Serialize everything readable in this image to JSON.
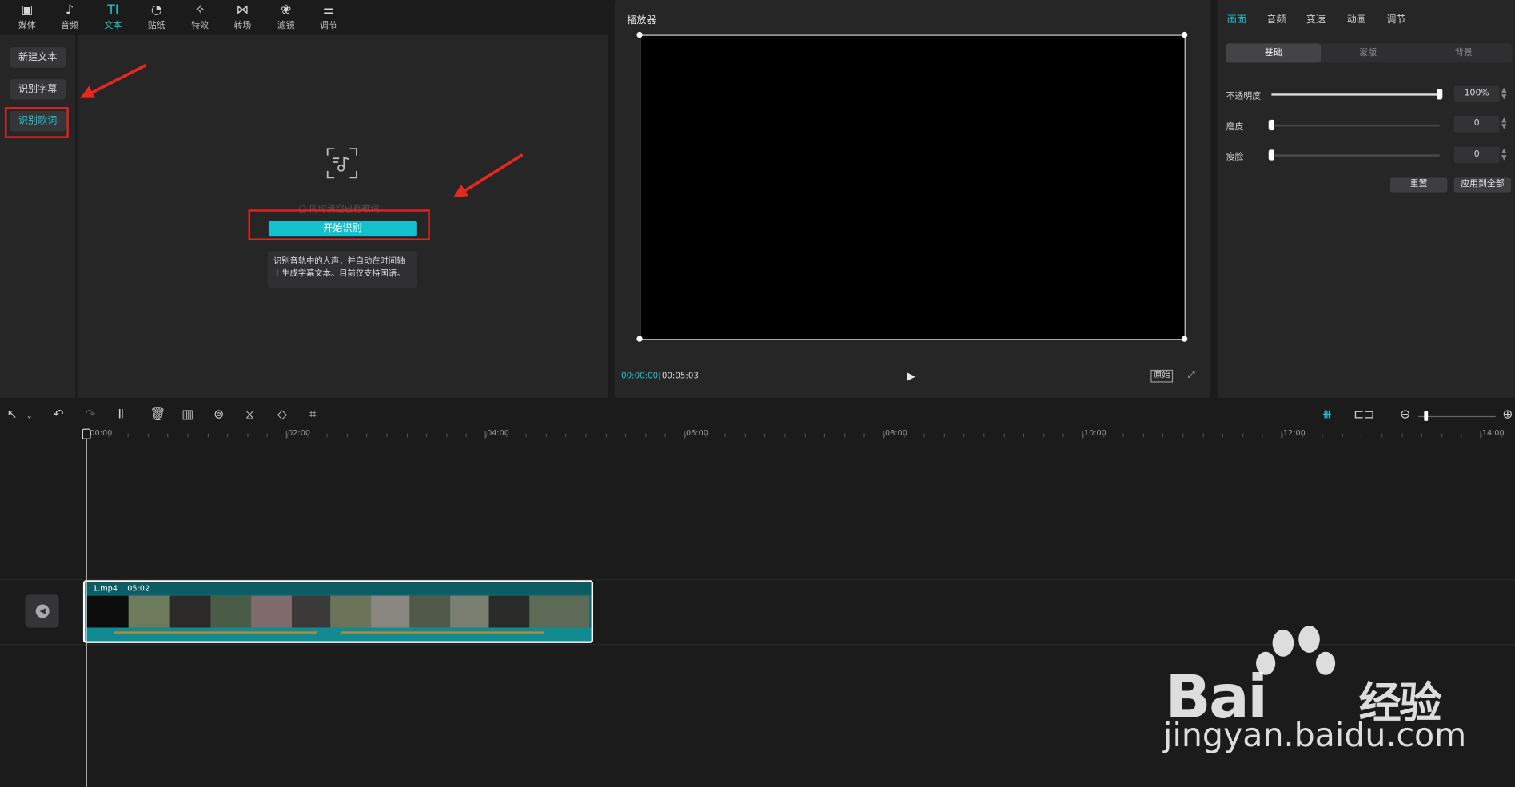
{
  "top_tabs": [
    {
      "label": "媒体",
      "icon": "media-icon",
      "glyph": "▣"
    },
    {
      "label": "音频",
      "icon": "audio-icon",
      "glyph": "♪"
    },
    {
      "label": "文本",
      "icon": "text-icon",
      "glyph": "TI"
    },
    {
      "label": "贴纸",
      "icon": "sticker-icon",
      "glyph": "◔"
    },
    {
      "label": "特效",
      "icon": "effects-icon",
      "glyph": "✧"
    },
    {
      "label": "转场",
      "icon": "transition-icon",
      "glyph": "⋈"
    },
    {
      "label": "滤镜",
      "icon": "filter-icon",
      "glyph": "❀"
    },
    {
      "label": "调节",
      "icon": "adjust-icon",
      "glyph": "⚌"
    }
  ],
  "active_tab": "文本",
  "left_nav": {
    "new_text": "新建文本",
    "auto_caption": "识别字幕",
    "lyrics": "识别歌词"
  },
  "lyrics_panel": {
    "clear_option": "同时清空已有歌词",
    "start_button": "开始识别",
    "tooltip": "识别音轨中的人声，并自动在时间轴上生成字幕文本。目前仅支持国语。"
  },
  "player": {
    "title": "播放器",
    "current_time": "00:00:00",
    "total_time": "00:05:03",
    "ratio_button": "原始"
  },
  "right_panel": {
    "tabs": [
      "画面",
      "音频",
      "变速",
      "动画",
      "调节"
    ],
    "active_tab": "画面",
    "segments": [
      "基础",
      "蒙版",
      "背景"
    ],
    "active_segment": "基础",
    "opacity_label": "不透明度",
    "opacity_value": "100%",
    "smooth_label": "磨皮",
    "smooth_value": "0",
    "slim_label": "瘦脸",
    "slim_value": "0",
    "reset_button": "重置",
    "apply_all_button": "应用到全部"
  },
  "timeline": {
    "ruler": [
      "00:00",
      "02:00",
      "04:00",
      "06:00",
      "08:00",
      "10:00",
      "12:00",
      "14:00"
    ],
    "clip_name": "1.mp4",
    "clip_duration": "05:02"
  },
  "watermark": {
    "logo_text": "Bai",
    "logo_text2": "经验",
    "url": "jingyan.baidu.com"
  },
  "colors": {
    "accent": "#1fc2cf",
    "annotation_red": "#e02424",
    "panel_bg": "#262627"
  }
}
